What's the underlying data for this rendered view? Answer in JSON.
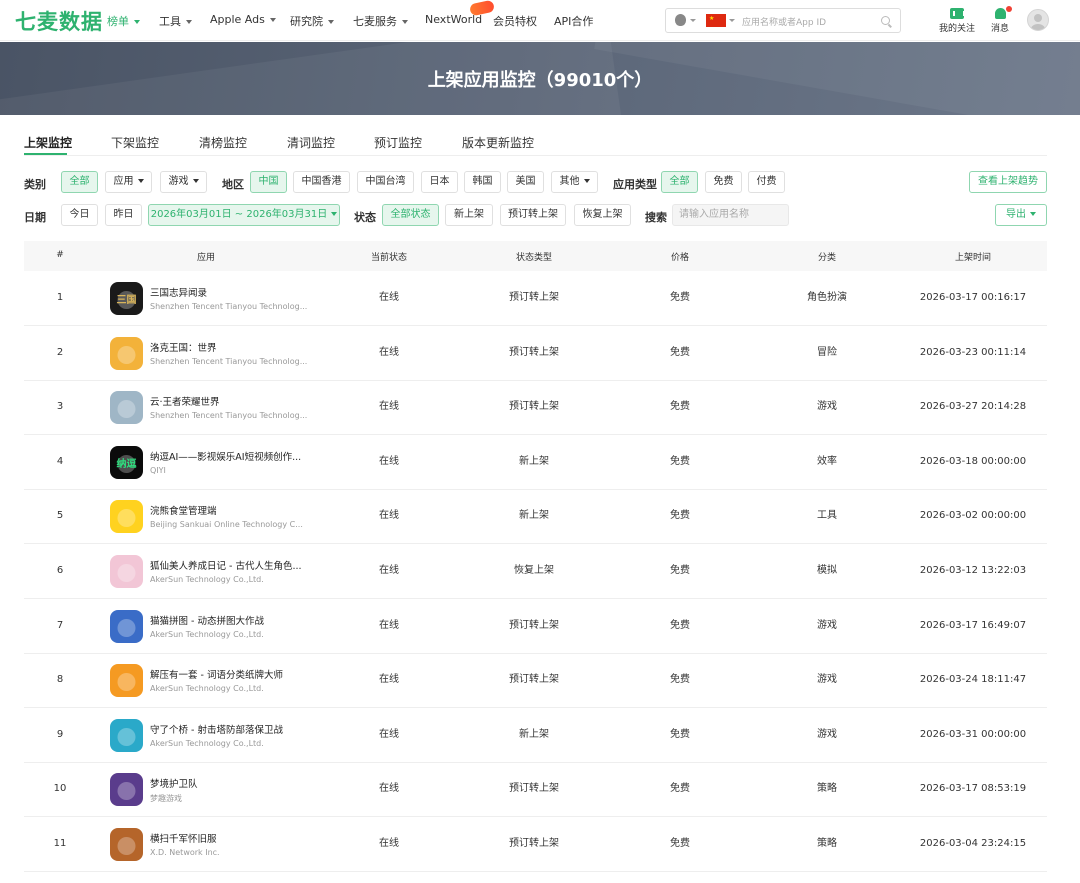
{
  "brand": {
    "logo": "七麦数据",
    "accent": "#2eb26f"
  },
  "nav": {
    "items": [
      {
        "label": "榜单",
        "caret": true
      },
      {
        "label": "工具",
        "caret": true
      },
      {
        "label": "Apple Ads",
        "caret": true
      },
      {
        "label": "研究院",
        "caret": true
      },
      {
        "label": "七麦服务",
        "caret": true
      },
      {
        "label": "NextWorld",
        "caret": false
      },
      {
        "label": "会员特权",
        "caret": false
      },
      {
        "label": "API合作",
        "caret": false
      }
    ],
    "search_placeholder": "应用名称或者App ID",
    "favorites_label": "我的关注",
    "messages_label": "消息"
  },
  "banner": {
    "title": "上架应用监控（99010个）"
  },
  "tabs": [
    "上架监控",
    "下架监控",
    "清榜监控",
    "清词监控",
    "预订监控",
    "版本更新监控"
  ],
  "filters": {
    "category_label": "类别",
    "category_all": "全部",
    "category_app": "应用",
    "category_game": "游戏",
    "region_label": "地区",
    "regions": [
      "中国",
      "中国香港",
      "中国台湾",
      "日本",
      "韩国",
      "美国"
    ],
    "region_other": "其他",
    "apptype_label": "应用类型",
    "apptypes": [
      "全部",
      "免费",
      "付费"
    ],
    "trend_button": "查看上架趋势",
    "date_label": "日期",
    "date_today": "今日",
    "date_yesterday": "昨日",
    "date_range": "2026年03月01日 ~ 2026年03月31日",
    "status_label": "状态",
    "statuses": [
      "全部状态",
      "新上架",
      "预订转上架",
      "恢复上架"
    ],
    "search_label": "搜索",
    "search_placeholder": "请输入应用名称",
    "export_button": "导出"
  },
  "table": {
    "headers": [
      "#",
      "应用",
      "当前状态",
      "状态类型",
      "价格",
      "分类",
      "上架时间"
    ],
    "rows": [
      {
        "rank": "1",
        "name": "三国志异闻录",
        "developer": "Shenzhen Tencent Tianyou Technolog...",
        "status": "在线",
        "type": "预订转上架",
        "price": "免费",
        "category": "角色扮演",
        "time": "2026-03-17 00:16:17",
        "icon_text": "三国",
        "icon_bg": "#1a1a1a",
        "icon_fg": "#d8b45a"
      },
      {
        "rank": "2",
        "name": "洛克王国：世界",
        "developer": "Shenzhen Tencent Tianyou Technolog...",
        "status": "在线",
        "type": "预订转上架",
        "price": "免费",
        "category": "冒险",
        "time": "2026-03-23 00:11:14",
        "icon_text": "",
        "icon_bg": "#f3b23a",
        "icon_fg": "#ffffff"
      },
      {
        "rank": "3",
        "name": "云·王者荣耀世界",
        "developer": "Shenzhen Tencent Tianyou Technolog...",
        "status": "在线",
        "type": "预订转上架",
        "price": "免费",
        "category": "游戏",
        "time": "2026-03-27 20:14:28",
        "icon_text": "",
        "icon_bg": "#9fb6c6",
        "icon_fg": "#ffffff"
      },
      {
        "rank": "4",
        "name": "纳逗AI——影视娱乐AI短视频创作...",
        "developer": "QIYI",
        "status": "在线",
        "type": "新上架",
        "price": "免费",
        "category": "效率",
        "time": "2026-03-18 00:00:00",
        "icon_text": "纳逗",
        "icon_bg": "#0b0b0b",
        "icon_fg": "#2ee07f"
      },
      {
        "rank": "5",
        "name": "浣熊食堂管理端",
        "developer": "Beijing Sankuai Online Technology C...",
        "status": "在线",
        "type": "新上架",
        "price": "免费",
        "category": "工具",
        "time": "2026-03-02 00:00:00",
        "icon_text": "",
        "icon_bg": "#ffd21f",
        "icon_fg": "#222222"
      },
      {
        "rank": "6",
        "name": "狐仙美人养成日记 - 古代人生角色...",
        "developer": "AkerSun Technology Co.,Ltd.",
        "status": "在线",
        "type": "恢复上架",
        "price": "免费",
        "category": "模拟",
        "time": "2026-03-12 13:22:03",
        "icon_text": "",
        "icon_bg": "#f2c6d6",
        "icon_fg": "#ffffff"
      },
      {
        "rank": "7",
        "name": "猫猫拼图 - 动态拼图大作战",
        "developer": "AkerSun Technology Co.,Ltd.",
        "status": "在线",
        "type": "预订转上架",
        "price": "免费",
        "category": "游戏",
        "time": "2026-03-17 16:49:07",
        "icon_text": "",
        "icon_bg": "#3a6cc7",
        "icon_fg": "#ffffff"
      },
      {
        "rank": "8",
        "name": "解压有一套 - 词语分类纸牌大师",
        "developer": "AkerSun Technology Co.,Ltd.",
        "status": "在线",
        "type": "预订转上架",
        "price": "免费",
        "category": "游戏",
        "time": "2026-03-24 18:11:47",
        "icon_text": "",
        "icon_bg": "#f59a22",
        "icon_fg": "#ffffff"
      },
      {
        "rank": "9",
        "name": "守了个桥 - 射击塔防部落保卫战",
        "developer": "AkerSun Technology Co.,Ltd.",
        "status": "在线",
        "type": "新上架",
        "price": "免费",
        "category": "游戏",
        "time": "2026-03-31 00:00:00",
        "icon_text": "",
        "icon_bg": "#2aa9c9",
        "icon_fg": "#ffffff"
      },
      {
        "rank": "10",
        "name": "梦境护卫队",
        "developer": "梦趣游戏",
        "status": "在线",
        "type": "预订转上架",
        "price": "免费",
        "category": "策略",
        "time": "2026-03-17 08:53:19",
        "icon_text": "",
        "icon_bg": "#5a3c8c",
        "icon_fg": "#ffffff"
      },
      {
        "rank": "11",
        "name": "横扫千军怀旧服",
        "developer": "X.D. Network Inc.",
        "status": "在线",
        "type": "预订转上架",
        "price": "免费",
        "category": "策略",
        "time": "2026-03-04 23:24:15",
        "icon_text": "",
        "icon_bg": "#b5652a",
        "icon_fg": "#ffffff"
      }
    ]
  }
}
